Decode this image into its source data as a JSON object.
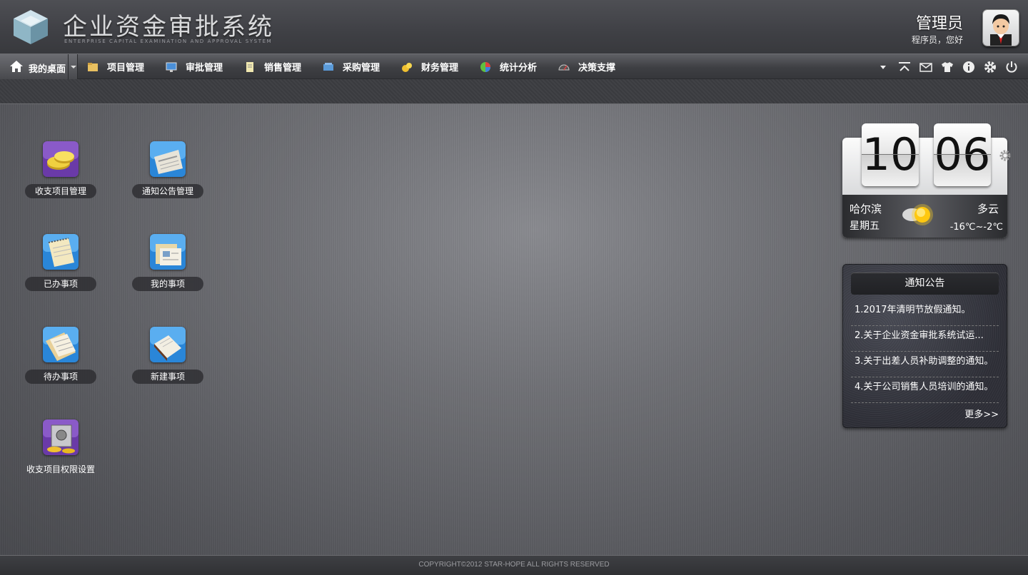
{
  "header": {
    "title": "企业资金审批系统",
    "subtitle": "ENTERPRISE CAPITAL EXAMINATION AND APPROVAL SYSTEM",
    "user_name": "管理员",
    "user_greeting": "程序员，您好"
  },
  "nav": {
    "home_label": "我的桌面",
    "items": [
      {
        "label": "项目管理",
        "icon": "folder-icon",
        "color": "#e8c060"
      },
      {
        "label": "审批管理",
        "icon": "monitor-icon",
        "color": "#4a8fd8"
      },
      {
        "label": "销售管理",
        "icon": "document-icon",
        "color": "#e0d080"
      },
      {
        "label": "采购管理",
        "icon": "cart-icon",
        "color": "#5a9ad8"
      },
      {
        "label": "财务管理",
        "icon": "coins-icon",
        "color": "#f0c030"
      },
      {
        "label": "统计分析",
        "icon": "pie-chart-icon",
        "color": "#60c040"
      },
      {
        "label": "决策支撑",
        "icon": "gauge-icon",
        "color": "#c04040"
      }
    ],
    "tools": [
      "dropdown-icon",
      "collapse-icon",
      "mail-icon",
      "shirt-icon",
      "info-icon",
      "gear-icon",
      "power-icon"
    ]
  },
  "desktop": {
    "icons": [
      {
        "label": "收支项目管理",
        "icon": "gold-coins-icon"
      },
      {
        "label": "通知公告管理",
        "icon": "newspaper-icon"
      },
      {
        "label": "已办事项",
        "icon": "notepad-icon"
      },
      {
        "label": "我的事项",
        "icon": "files-icon"
      },
      {
        "label": "待办事项",
        "icon": "papers-icon"
      },
      {
        "label": "新建事项",
        "icon": "book-icon"
      },
      {
        "label": "收支项目权限设置",
        "icon": "safe-icon"
      }
    ]
  },
  "clock": {
    "hours": "10",
    "minutes": "06",
    "city": "哈尔滨",
    "weekday": "星期五",
    "condition": "多云",
    "temperature": "-16℃~-2℃"
  },
  "notices": {
    "title": "通知公告",
    "items": [
      "1.2017年清明节放假通知。",
      "2.关于企业资金审批系统试运...",
      "3.关于出差人员补助调整的通知。",
      "4.关于公司销售人员培训的通知。"
    ],
    "more": "更多>>"
  },
  "footer": {
    "copyright": "COPYRIGHT©2012 STAR-HOPE ALL RIGHTS RESERVED"
  }
}
